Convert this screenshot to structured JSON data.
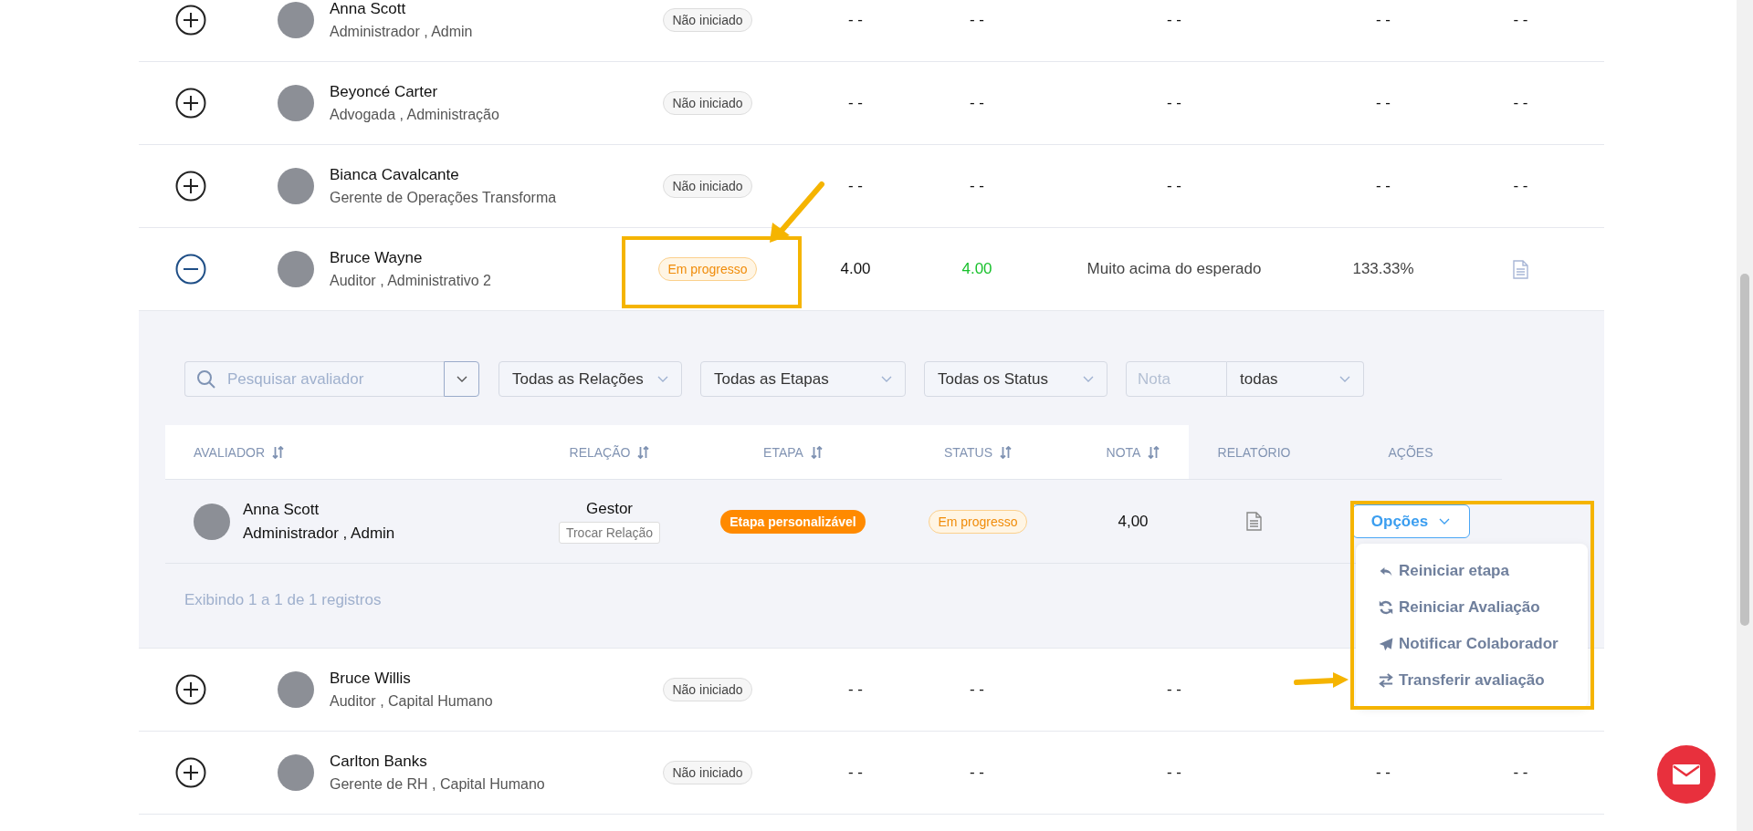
{
  "people": [
    {
      "name": "Anna Scott",
      "role": "Administrador , Admin",
      "expanded": false,
      "status": {
        "label": "Não iniciado",
        "kind": "not_started"
      },
      "cells": [
        {
          "kind": "text",
          "text": "- -"
        },
        {
          "kind": "text",
          "text": "- -"
        },
        {
          "kind": "text",
          "text": "- -"
        },
        {
          "kind": "text",
          "text": "- -"
        },
        {
          "kind": "text",
          "text": "- -"
        }
      ]
    },
    {
      "name": "Beyoncé Carter",
      "role": "Advogada , Administração",
      "expanded": false,
      "status": {
        "label": "Não iniciado",
        "kind": "not_started"
      },
      "cells": [
        {
          "kind": "text",
          "text": "- -"
        },
        {
          "kind": "text",
          "text": "- -"
        },
        {
          "kind": "text",
          "text": "- -"
        },
        {
          "kind": "text",
          "text": "- -"
        },
        {
          "kind": "text",
          "text": "- -"
        }
      ]
    },
    {
      "name": "Bianca Cavalcante",
      "role": "Gerente de Operações Transforma",
      "expanded": false,
      "status": {
        "label": "Não iniciado",
        "kind": "not_started"
      },
      "cells": [
        {
          "kind": "text",
          "text": "- -"
        },
        {
          "kind": "text",
          "text": "- -"
        },
        {
          "kind": "text",
          "text": "- -"
        },
        {
          "kind": "text",
          "text": "- -"
        },
        {
          "kind": "text",
          "text": "- -"
        }
      ]
    },
    {
      "name": "Bruce Wayne",
      "role": "Auditor , Administrativo 2",
      "expanded": true,
      "status": {
        "label": "Em progresso",
        "kind": "in_progress"
      },
      "cells": [
        {
          "kind": "text",
          "text": "4.00"
        },
        {
          "kind": "positive",
          "text": "4.00"
        },
        {
          "kind": "muted",
          "text": "Muito acima do esperado"
        },
        {
          "kind": "muted",
          "text": "133.33%"
        },
        {
          "kind": "report"
        }
      ]
    },
    {
      "name": "Bruce Willis",
      "role": "Auditor , Capital Humano",
      "expanded": false,
      "status": {
        "label": "Não iniciado",
        "kind": "not_started"
      },
      "cells": [
        {
          "kind": "text",
          "text": "- -"
        },
        {
          "kind": "text",
          "text": "- -"
        },
        {
          "kind": "text",
          "text": "- -"
        }
      ]
    },
    {
      "name": "Carlton Banks",
      "role": "Gerente de RH , Capital Humano",
      "expanded": false,
      "status": {
        "label": "Não iniciado",
        "kind": "not_started"
      },
      "cells": [
        {
          "kind": "text",
          "text": "- -"
        },
        {
          "kind": "text",
          "text": "- -"
        },
        {
          "kind": "text",
          "text": "- -"
        },
        {
          "kind": "text",
          "text": "- -"
        },
        {
          "kind": "text",
          "text": "- -"
        }
      ]
    }
  ],
  "details": {
    "filters": {
      "search_placeholder": "Pesquisar avaliador",
      "relations": "Todas as Relações",
      "stages": "Todas as Etapas",
      "statuses": "Todas os Status",
      "grade_placeholder": "Nota",
      "grade_scope": "todas"
    },
    "columns": [
      {
        "label": "AVALIADOR",
        "sortable": true
      },
      {
        "label": "RELAÇÃO",
        "sortable": true
      },
      {
        "label": "ETAPA",
        "sortable": true
      },
      {
        "label": "STATUS",
        "sortable": true
      },
      {
        "label": "NOTA",
        "sortable": true
      },
      {
        "label": "RELATÓRIO",
        "sortable": false
      },
      {
        "label": "AÇÕES",
        "sortable": false
      }
    ],
    "rows": [
      {
        "name": "Anna Scott",
        "role": "Administrador , Admin",
        "relation": "Gestor",
        "change_relation": "Trocar Relação",
        "stage": "Etapa personalizável",
        "status": {
          "label": "Em progresso",
          "kind": "in_progress"
        },
        "grade": "4,00",
        "actions": {
          "label": "Opções",
          "expanded": true,
          "items": [
            {
              "label": "Reiniciar etapa"
            },
            {
              "label": "Reiniciar Avaliação"
            },
            {
              "label": "Notificar Colaborador"
            },
            {
              "label": "Transferir avaliação"
            }
          ]
        }
      }
    ],
    "footer": "Exibindo 1 a 1 de 1 registros"
  }
}
